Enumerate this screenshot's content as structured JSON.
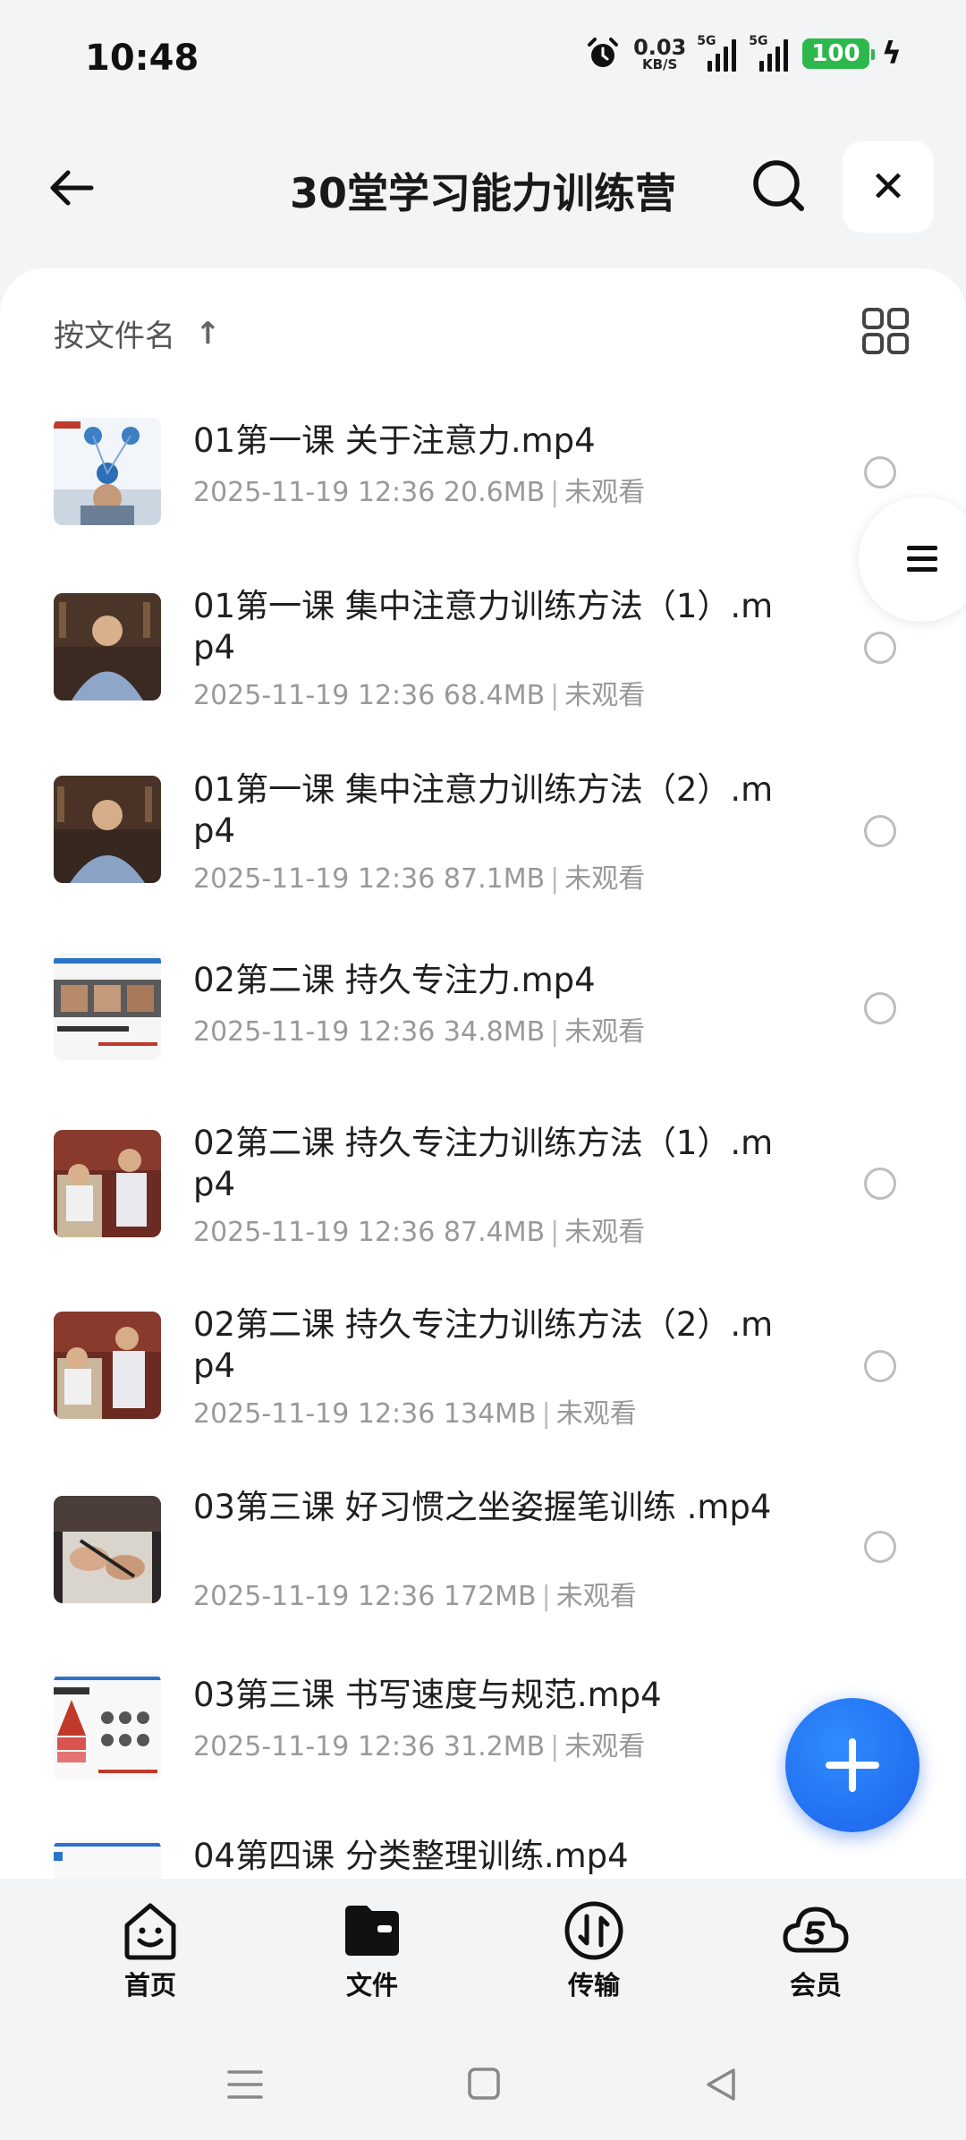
{
  "status_bar": {
    "time": "10:48",
    "net_speed_value": "0.03",
    "net_speed_unit": "KB/S",
    "signal1_label": "5G",
    "signal2_label": "5G",
    "battery": "100"
  },
  "header": {
    "title": "30堂学习能力训练营",
    "close_label": "✕"
  },
  "sort": {
    "label": "按文件名",
    "arrow": "↑"
  },
  "files": [
    {
      "name": "01第一课 关于注意力.mp4",
      "date": "2025-11-19 12:36",
      "size": "20.6MB",
      "status": "未观看"
    },
    {
      "name": "01第一课 集中注意力训练方法（1）.mp4",
      "date": "2025-11-19 12:36",
      "size": "68.4MB",
      "status": "未观看"
    },
    {
      "name": "01第一课 集中注意力训练方法（2）.mp4",
      "date": "2025-11-19 12:36",
      "size": "87.1MB",
      "status": "未观看"
    },
    {
      "name": "02第二课 持久专注力.mp4",
      "date": "2025-11-19 12:36",
      "size": "34.8MB",
      "status": "未观看"
    },
    {
      "name": "02第二课 持久专注力训练方法（1）.mp4",
      "date": "2025-11-19 12:36",
      "size": "87.4MB",
      "status": "未观看"
    },
    {
      "name": "02第二课 持久专注力训练方法（2）.mp4",
      "date": "2025-11-19 12:36",
      "size": "134MB",
      "status": "未观看"
    },
    {
      "name": "03第三课 好习惯之坐姿握笔训练 .mp4",
      "date": "2025-11-19 12:36",
      "size": "172MB",
      "status": "未观看"
    },
    {
      "name": "03第三课 书写速度与规范.mp4",
      "date": "2025-11-19 12:36",
      "size": "31.2MB",
      "status": "未观看"
    },
    {
      "name": "04第四课 分类整理训练.mp4",
      "date": "",
      "size": "",
      "status": ""
    }
  ],
  "nav": {
    "home": "首页",
    "files": "文件",
    "transfer": "传输",
    "vip": "会员"
  },
  "colors": {
    "accent": "#1c63ea",
    "battery": "#2db84d"
  }
}
